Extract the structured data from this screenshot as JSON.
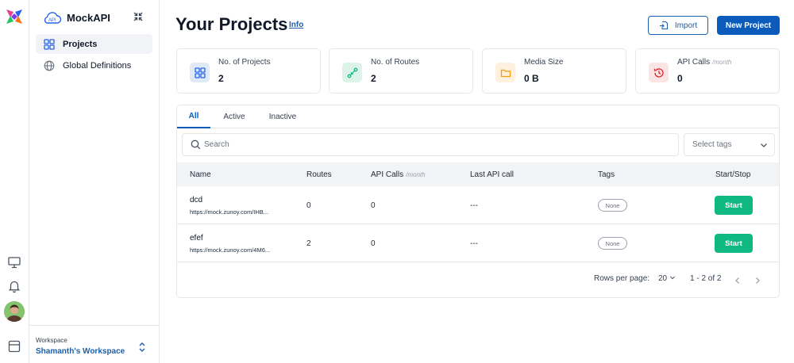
{
  "app": {
    "name": "MockAPI"
  },
  "sidebar": {
    "items": [
      {
        "label": "Projects",
        "icon": "grid-icon",
        "active": true
      },
      {
        "label": "Global Definitions",
        "icon": "globe-icon",
        "active": false
      }
    ],
    "workspace": {
      "label": "Workspace",
      "name": "Shamanth's Workspace"
    }
  },
  "header": {
    "title": "Your Projects",
    "info_link": "Info",
    "import_label": "Import",
    "new_project_label": "New Project"
  },
  "stats": [
    {
      "label": "No. of Projects",
      "sub": "",
      "value": "2",
      "icon": "grid-icon",
      "color": "#2563eb",
      "bg": "#e0eaf6"
    },
    {
      "label": "No. of Routes",
      "sub": "",
      "value": "2",
      "icon": "route-icon",
      "color": "#10b981",
      "bg": "#dcf3ea"
    },
    {
      "label": "Media Size",
      "sub": "",
      "value": "0 B",
      "icon": "folder-icon",
      "color": "#f59e0b",
      "bg": "#fdf0dc"
    },
    {
      "label": "API Calls",
      "sub": "/month",
      "value": "0",
      "icon": "history-icon",
      "color": "#dc2626",
      "bg": "#fbe4e4"
    }
  ],
  "tabs": [
    {
      "label": "All",
      "active": true
    },
    {
      "label": "Active",
      "active": false
    },
    {
      "label": "Inactive",
      "active": false
    }
  ],
  "search": {
    "placeholder": "Search"
  },
  "tag_select": {
    "placeholder": "Select tags"
  },
  "table": {
    "columns": {
      "name": "Name",
      "routes": "Routes",
      "api_calls": "API Calls",
      "api_calls_sub": "/month",
      "last_call": "Last API call",
      "tags": "Tags",
      "start_stop": "Start/Stop"
    },
    "rows": [
      {
        "name": "dcd",
        "url": "https://mock.zunoy.com/IHB...",
        "routes": "0",
        "api_calls": "0",
        "last_call": "---",
        "tags": "None",
        "action": "Start"
      },
      {
        "name": "efef",
        "url": "https://mock.zunoy.com/4M6...",
        "routes": "2",
        "api_calls": "0",
        "last_call": "---",
        "tags": "None",
        "action": "Start"
      }
    ]
  },
  "pagination": {
    "rows_label": "Rows per page:",
    "rows_value": "20",
    "range": "1 - 2 of 2"
  },
  "colors": {
    "primary": "#0b5cba",
    "success": "#10b981",
    "link": "#1d5fa8"
  }
}
